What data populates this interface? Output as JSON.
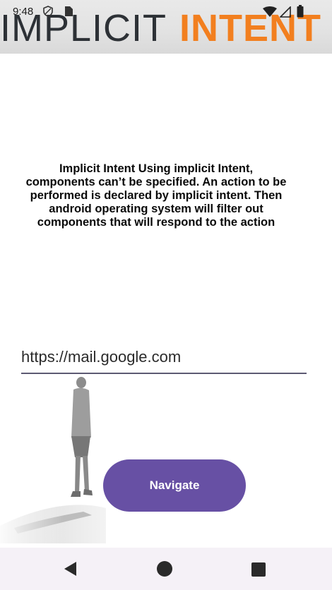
{
  "status_bar": {
    "time": "9:48",
    "icons": [
      "shield-icon",
      "sim-card-icon",
      "wifi-icon",
      "signal-icon",
      "battery-icon"
    ]
  },
  "banner": {
    "word1": "IMPLICIT",
    "word2": "INTENT",
    "color_dark": "#2d3136",
    "color_accent": "#f27f1f"
  },
  "description": "Implicit Intent Using implicit Intent, components can’t be specified. An action to be performed is declared by implicit intent. Then android operating system will filter out components that will respond to the action",
  "url_input": {
    "value": "https://mail.google.com"
  },
  "navigate_button": {
    "label": "Navigate",
    "color": "#6750a4"
  },
  "system_nav": {
    "icons": [
      "back-icon",
      "home-icon",
      "recents-icon"
    ]
  }
}
